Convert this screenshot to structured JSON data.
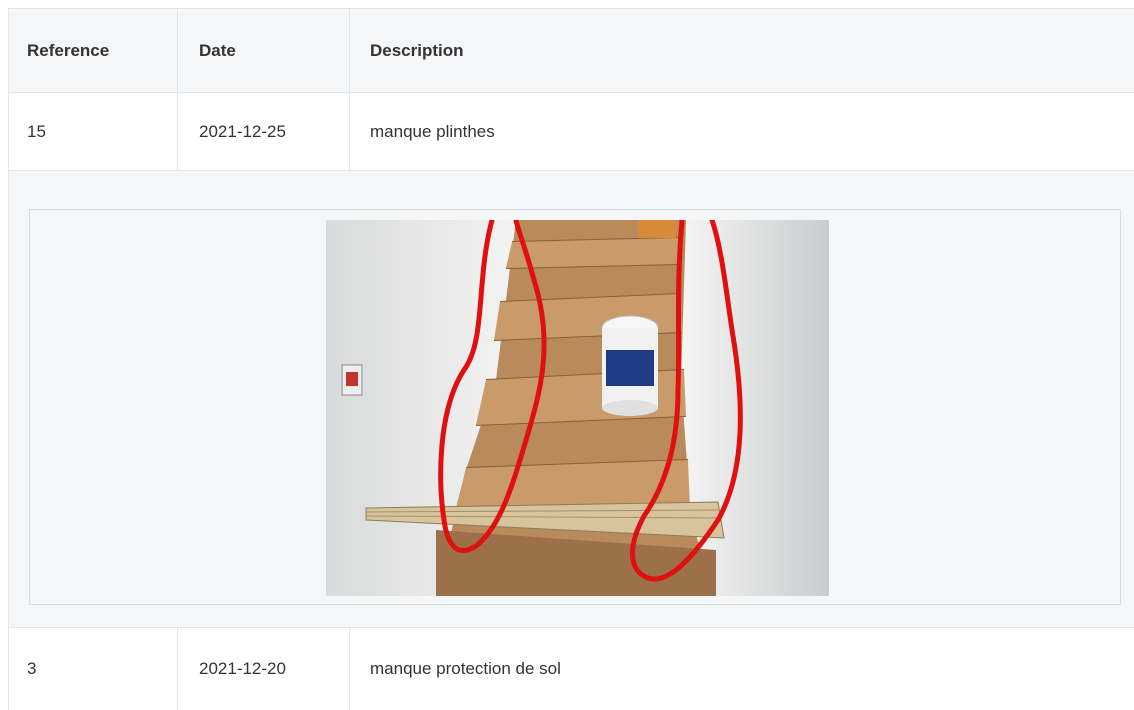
{
  "table": {
    "headers": {
      "reference": "Reference",
      "date": "Date",
      "description": "Description"
    },
    "rows": [
      {
        "reference": "15",
        "date": "2021-12-25",
        "description": "manque plinthes"
      },
      {
        "reference": "3",
        "date": "2021-12-20",
        "description": "manque protection de sol"
      }
    ]
  },
  "photo": {
    "subject": "wooden staircase with paint bucket and plank, missing baseboards circled in red",
    "annotation_color": "#e01010"
  }
}
